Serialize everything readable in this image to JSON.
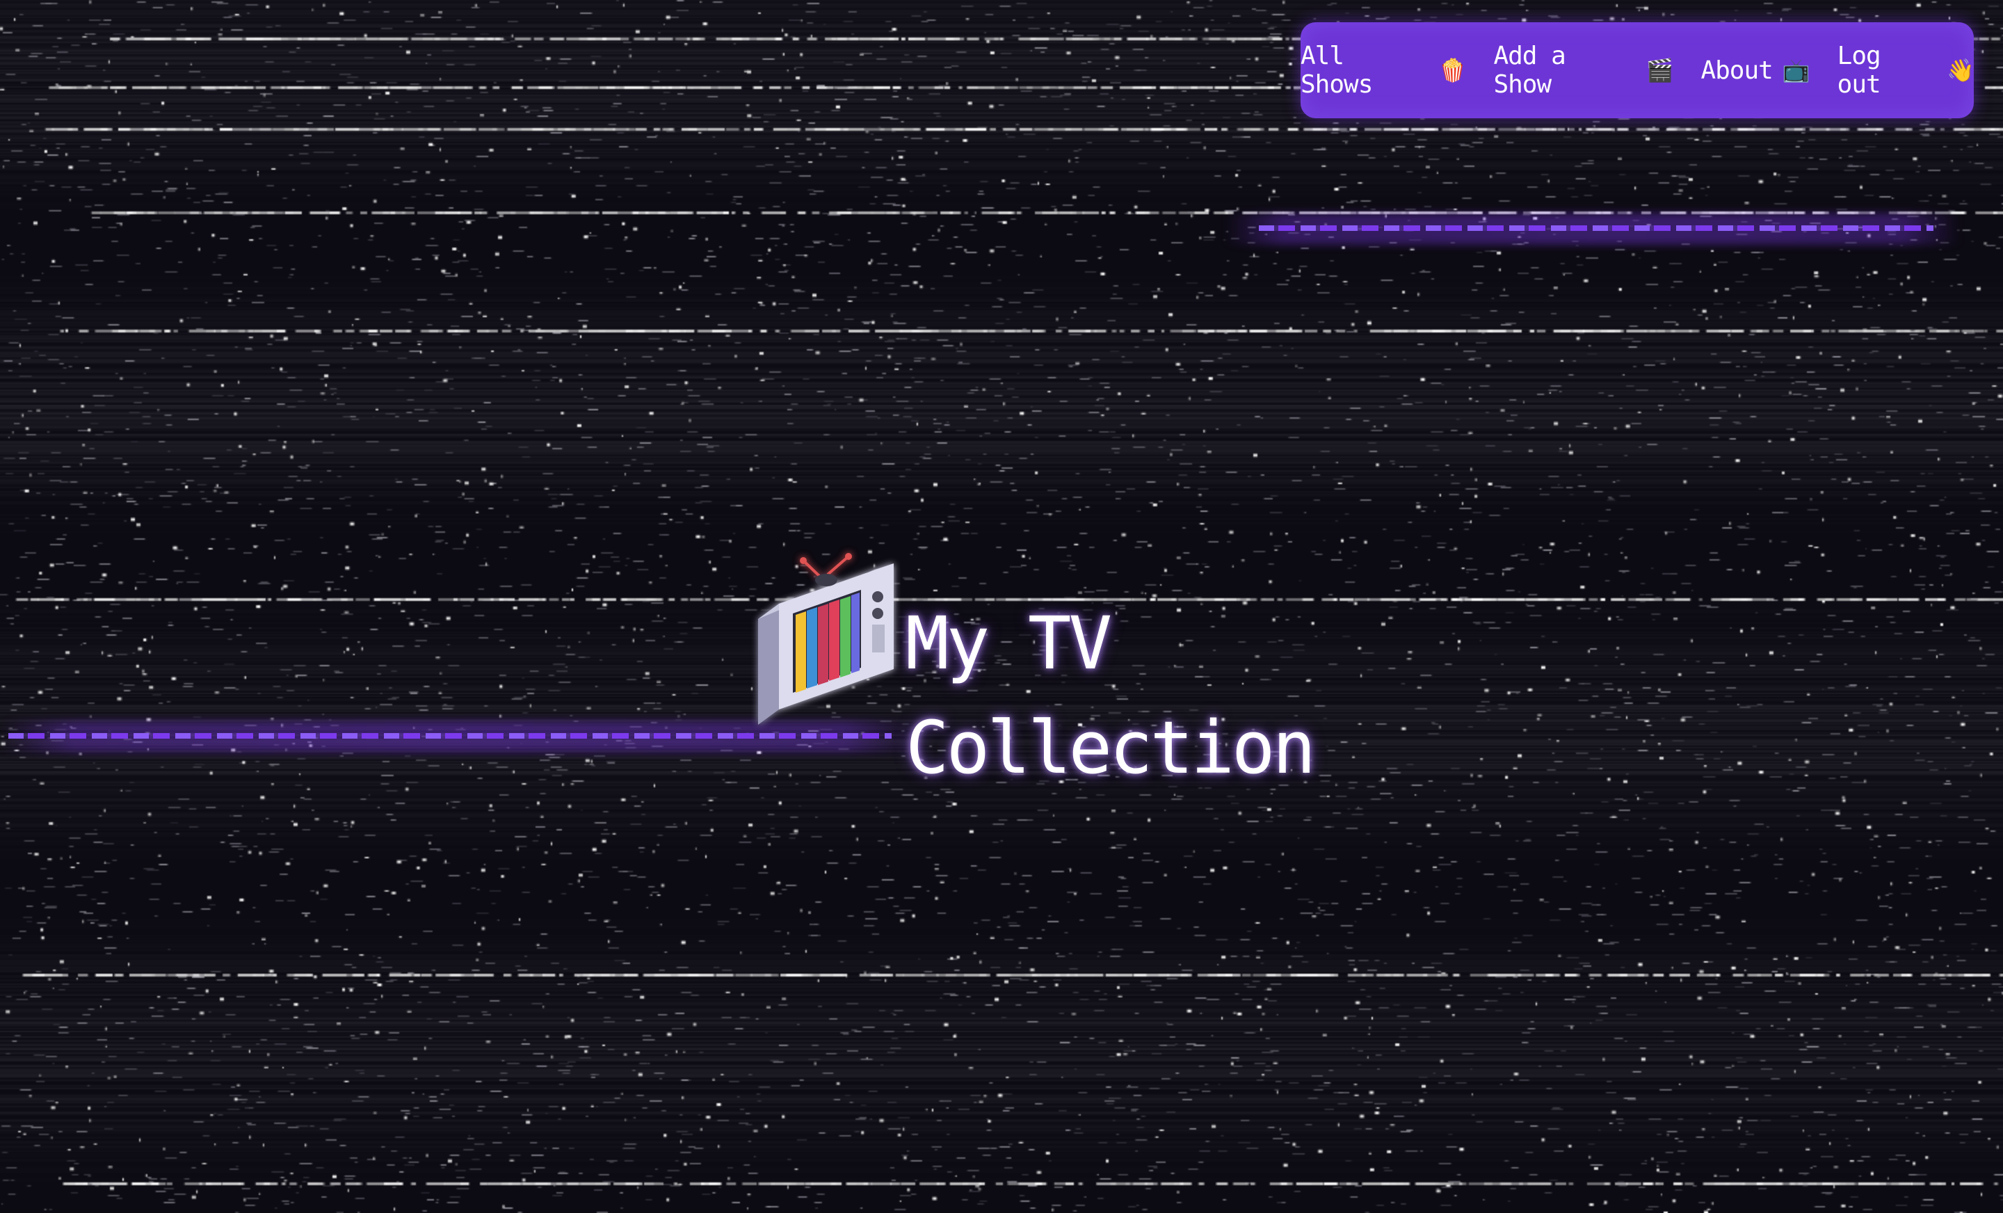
{
  "nav": {
    "items": [
      {
        "label": "All Shows",
        "emoji": "🍿",
        "icon": "popcorn-icon"
      },
      {
        "label": "Add a Show",
        "emoji": "🎬",
        "icon": "clapperboard-icon"
      },
      {
        "label": "About",
        "emoji": "📺",
        "icon": "tv-icon"
      },
      {
        "label": "Log out",
        "emoji": "👋",
        "icon": "waving-hand-icon"
      }
    ]
  },
  "hero": {
    "title": "My TV Collection",
    "logo_icon": "retro-tv-icon"
  },
  "colors": {
    "background": "#0d0a10",
    "nav_bg": "#6d35d6",
    "accent": "#7c3aed",
    "text": "#ffffff"
  }
}
